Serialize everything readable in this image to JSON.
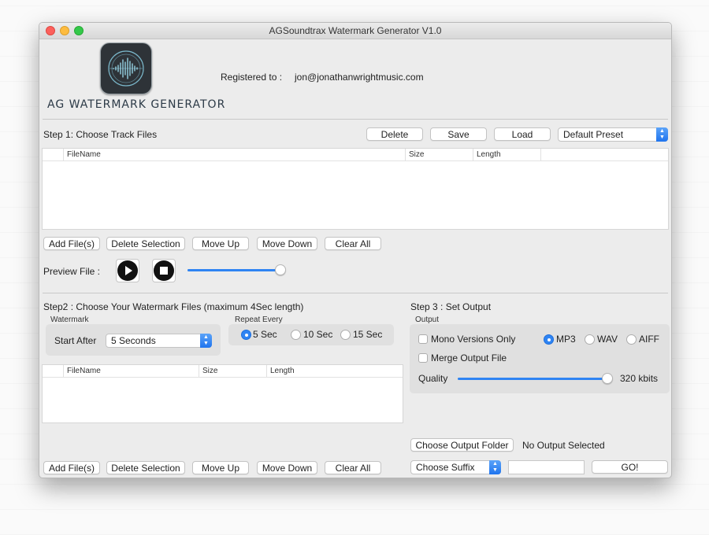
{
  "window": {
    "title": "AGSoundtrax Watermark Generator V1.0"
  },
  "header": {
    "logo_title": "AG WATERMARK GENERATOR",
    "registered_label": "Registered to :",
    "registered_email": "jon@jonathanwrightmusic.com"
  },
  "step1": {
    "title": "Step 1: Choose Track Files",
    "delete_label": "Delete",
    "save_label": "Save",
    "load_label": "Load",
    "preset": "Default Preset",
    "columns": [
      "FileName",
      "Size",
      "Length"
    ],
    "add_label": "Add File(s)",
    "delete_selection_label": "Delete Selection",
    "move_up_label": "Move Up",
    "move_down_label": "Move Down",
    "clear_all_label": "Clear All",
    "preview_label": "Preview File :",
    "preview_position": 0.98
  },
  "step2": {
    "title": "Step2 : Choose Your Watermark Files (maximum 4Sec length)",
    "watermark_group_label": "Watermark",
    "start_after_label": "Start After",
    "start_after_value": "5 Seconds",
    "repeat_group_label": "Repeat Every",
    "repeat_options": [
      "5 Sec",
      "10 Sec",
      "15 Sec"
    ],
    "repeat_selected": "5 Sec",
    "columns": [
      "FileName",
      "Size",
      "Length"
    ],
    "add_label": "Add File(s)",
    "delete_selection_label": "Delete Selection",
    "move_up_label": "Move Up",
    "move_down_label": "Move Down",
    "clear_all_label": "Clear All"
  },
  "step3": {
    "title": "Step 3 : Set Output",
    "output_group_label": "Output",
    "mono_label": "Mono Versions Only",
    "merge_label": "Merge Output File",
    "formats": [
      "MP3",
      "WAV",
      "AIFF"
    ],
    "format_selected": "MP3",
    "quality_label": "Quality",
    "quality_value": "320 kbits",
    "quality_position": 1.0,
    "choose_folder_label": "Choose Output Folder",
    "output_status": "No Output Selected",
    "suffix_label": "Choose Suffix",
    "suffix_value": "",
    "go_label": "GO!"
  },
  "colors": {
    "accent": "#2f84f3",
    "window_bg": "#ececec",
    "group_bg": "#e0e0e0"
  },
  "icons": [
    "close-light",
    "minimize-light",
    "zoom-light",
    "waveform-logo-icon",
    "play-icon",
    "stop-icon",
    "chevron-updown-icon"
  ]
}
